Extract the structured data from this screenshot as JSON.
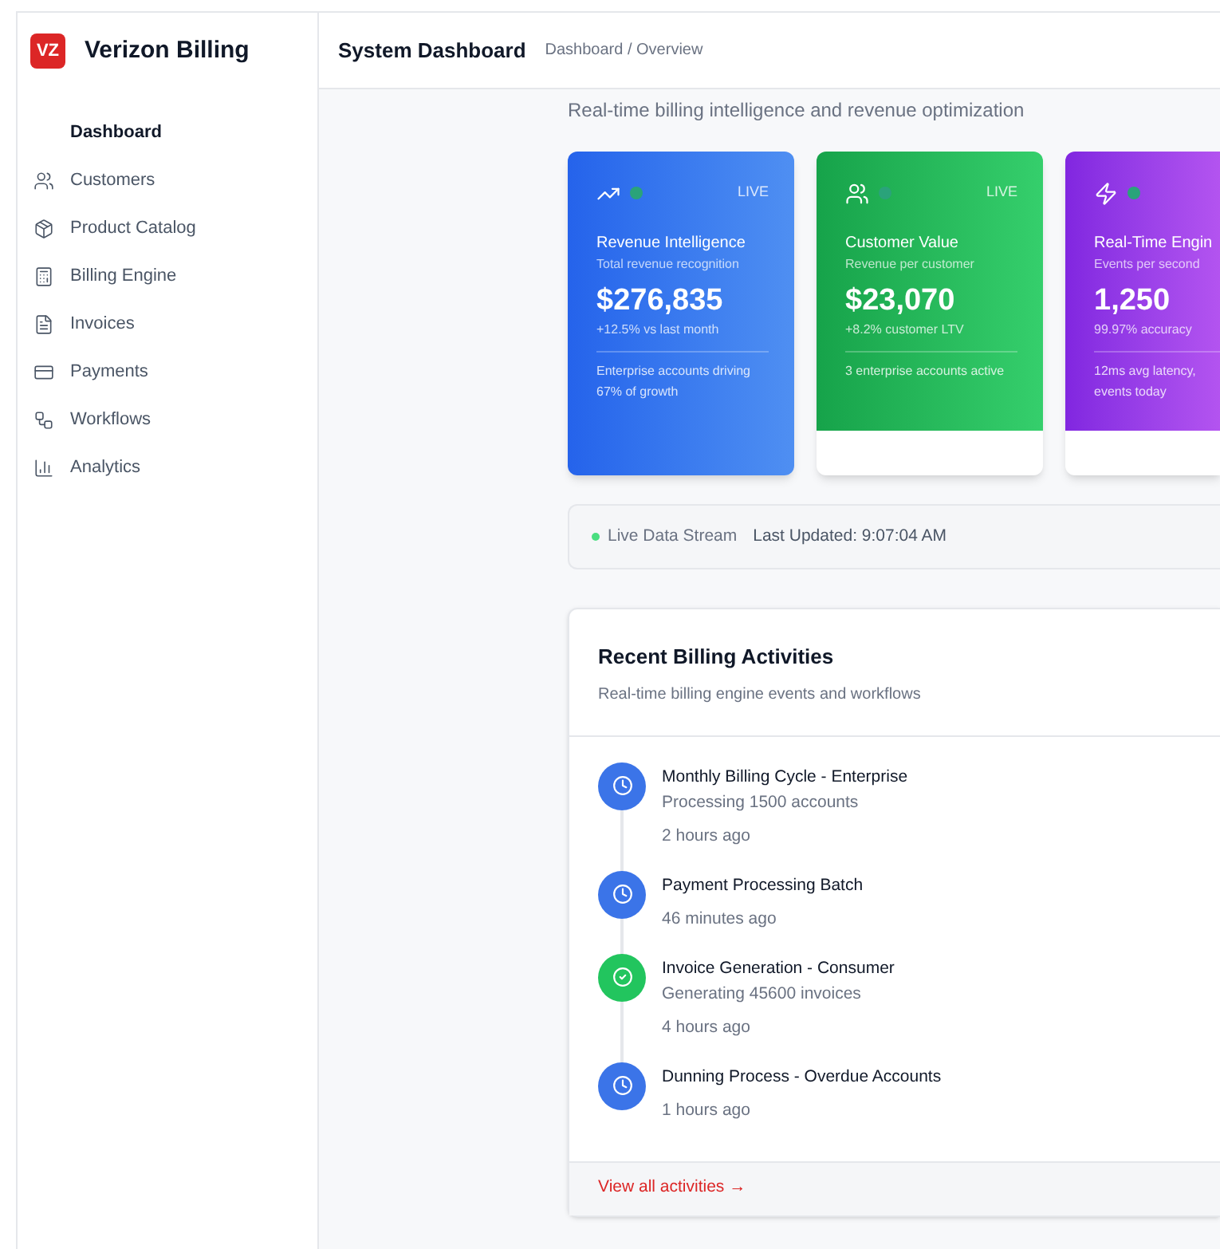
{
  "brand": {
    "logo": "VZ",
    "name": "Verizon Billing"
  },
  "sidebar": {
    "items": [
      {
        "label": "Dashboard",
        "selected": true
      },
      {
        "label": "Customers",
        "selected": false
      },
      {
        "label": "Product Catalog",
        "selected": false
      },
      {
        "label": "Billing Engine",
        "selected": false
      },
      {
        "label": "Invoices",
        "selected": false
      },
      {
        "label": "Payments",
        "selected": false
      },
      {
        "label": "Workflows",
        "selected": false
      },
      {
        "label": "Analytics",
        "selected": false
      }
    ]
  },
  "header": {
    "title": "System Dashboard",
    "breadcrumb": "Dashboard / Overview"
  },
  "subtitle": "Real-time billing intelligence and revenue optimization",
  "cards": [
    {
      "badge": "LIVE",
      "title": "Revenue Intelligence",
      "caption": "Total revenue recognition",
      "value": "$276,835",
      "change": "+12.5% vs last month",
      "footer": "Enterprise accounts driving 67% of growth"
    },
    {
      "badge": "LIVE",
      "title": "Customer Value",
      "caption": "Revenue per customer",
      "value": "$23,070",
      "change": "+8.2% customer LTV",
      "footer": "3 enterprise accounts active"
    },
    {
      "title": "Real-Time Engin",
      "caption": "Events per second",
      "value": "1,250",
      "change": "99.97% accuracy",
      "footer": "12ms avg latency, events today"
    }
  ],
  "stream": {
    "label": "Live Data Stream",
    "updated": "Last Updated: 9:07:04 AM"
  },
  "activities": {
    "title": "Recent Billing Activities",
    "subtitle": "Real-time billing engine events and workflows",
    "items": [
      {
        "kind": "pending",
        "title": "Monthly Billing Cycle - Enterprise",
        "detail": "Processing 1500 accounts",
        "time": "2 hours ago"
      },
      {
        "kind": "pending",
        "title": "Payment Processing Batch",
        "time": "46 minutes ago"
      },
      {
        "kind": "done",
        "title": "Invoice Generation - Consumer",
        "detail": "Generating 45600 invoices",
        "time": "4 hours ago"
      },
      {
        "kind": "pending",
        "title": "Dunning Process - Overdue Accounts",
        "time": "1 hours ago"
      }
    ],
    "link": "View all activities →"
  }
}
